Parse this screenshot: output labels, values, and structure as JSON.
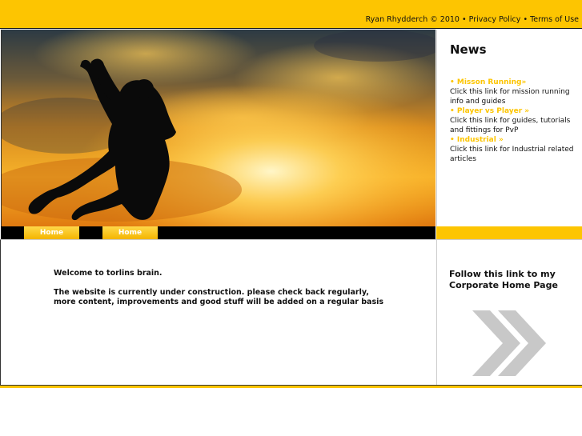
{
  "header": {
    "author": "Ryan Rhydderch",
    "copyright": "©",
    "year": "2010",
    "bullet": "•",
    "privacy": "Privacy Policy",
    "terms": "Terms of Use"
  },
  "nav": {
    "items": [
      {
        "label": "Home"
      },
      {
        "label": "Home"
      }
    ]
  },
  "news": {
    "title": "News",
    "items": [
      {
        "link": "• Misson Running»",
        "desc": "Click this link for mission running info and guides"
      },
      {
        "link": "• Player vs Player »",
        "desc": "Click this link for guides, tutorials and fittings for PvP"
      },
      {
        "link": "• Industrial »",
        "desc": "Click this link for Industrial related articles"
      }
    ]
  },
  "main": {
    "welcome": "Welcome to torlins brain.",
    "body": "The website is currently under construction. please check back regularly, more content, improvements and good stuff will be added on a regular basis"
  },
  "side": {
    "link": "Follow this link to my Corporate Home Page",
    "icon": "double-chevron-right-icon"
  },
  "colors": {
    "accent": "#fdc501",
    "nav_bar": "#000000",
    "text": "#111111"
  }
}
